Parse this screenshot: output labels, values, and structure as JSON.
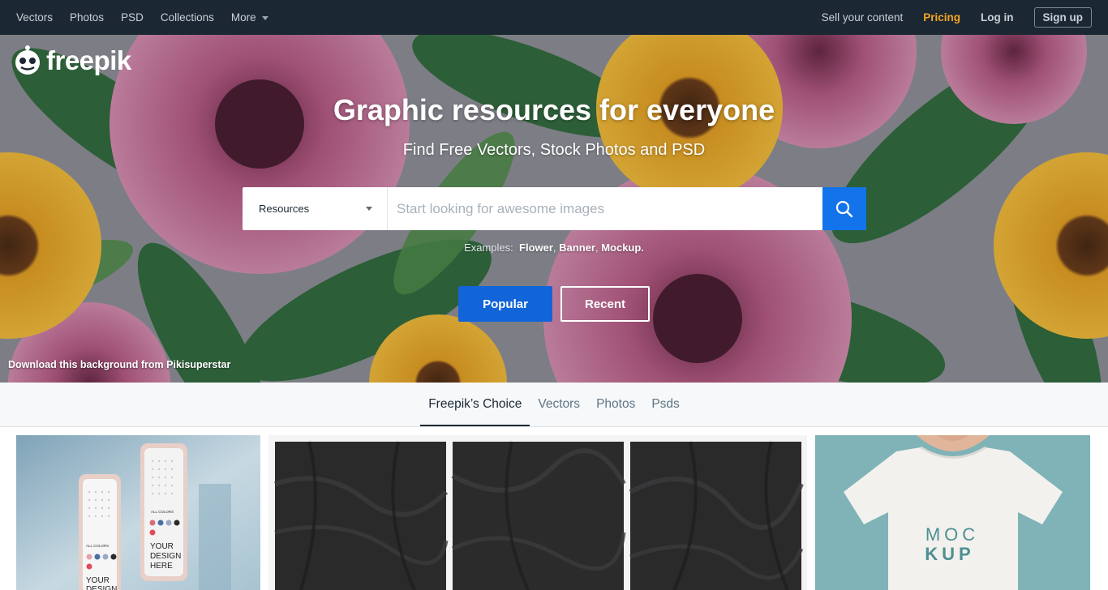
{
  "topnav": {
    "left": [
      {
        "label": "Vectors"
      },
      {
        "label": "Photos"
      },
      {
        "label": "PSD"
      },
      {
        "label": "Collections"
      },
      {
        "label": "More"
      }
    ],
    "sell": "Sell your content",
    "pricing": "Pricing",
    "login": "Log in",
    "signup": "Sign up"
  },
  "hero": {
    "logo_text": "freepik",
    "title": "Graphic resources for everyone",
    "subtitle": "Find Free Vectors, Stock Photos and PSD",
    "search": {
      "selected": "Resources",
      "placeholder": "Start looking for awesome images"
    },
    "examples": {
      "label": "Examples:",
      "items": [
        "Flower",
        "Banner",
        "Mockup."
      ]
    },
    "buttons": {
      "popular": "Popular",
      "recent": "Recent"
    },
    "credit": "Download this background from Pikisuperstar"
  },
  "tabs": [
    "Freepik’s Choice",
    "Vectors",
    "Photos",
    "Psds"
  ],
  "gallery": {
    "phone_texts": [
      "ALL COLORS",
      "YOUR",
      "DESIGN",
      "HERE"
    ],
    "tshirt_texts": [
      "MOC",
      "KUP"
    ]
  },
  "colors": {
    "nav_bg": "#1b2833",
    "pricing": "#f5a623",
    "search_button": "#1273eb",
    "popular_button": "#1264d9"
  }
}
